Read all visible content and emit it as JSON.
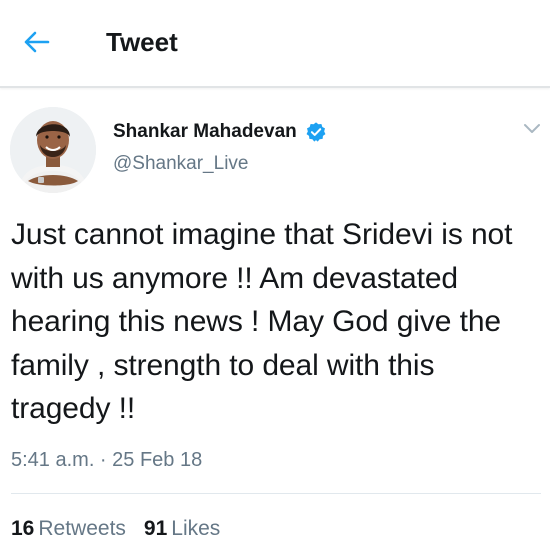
{
  "header": {
    "title": "Tweet",
    "back_icon": "arrow-left-icon",
    "accent_color": "#1da1f2"
  },
  "author": {
    "name": "Shankar Mahadevan",
    "handle": "@Shankar_Live",
    "verified": true,
    "avatar_icon": "avatar-photo"
  },
  "tweet": {
    "text": "Just cannot imagine that Sridevi is not with us anymore !! Am devastated hearing this news ! May God give the family , strength to deal with this tragedy !!",
    "timestamp": "5:41 a.m. · 25 Feb 18"
  },
  "stats": {
    "retweets_count": "16",
    "retweets_label": "Retweets",
    "likes_count": "91",
    "likes_label": "Likes"
  },
  "colors": {
    "text_primary": "#14171a",
    "text_secondary": "#657786",
    "divider": "#e1e8ed",
    "verified_blue": "#1da1f2"
  }
}
